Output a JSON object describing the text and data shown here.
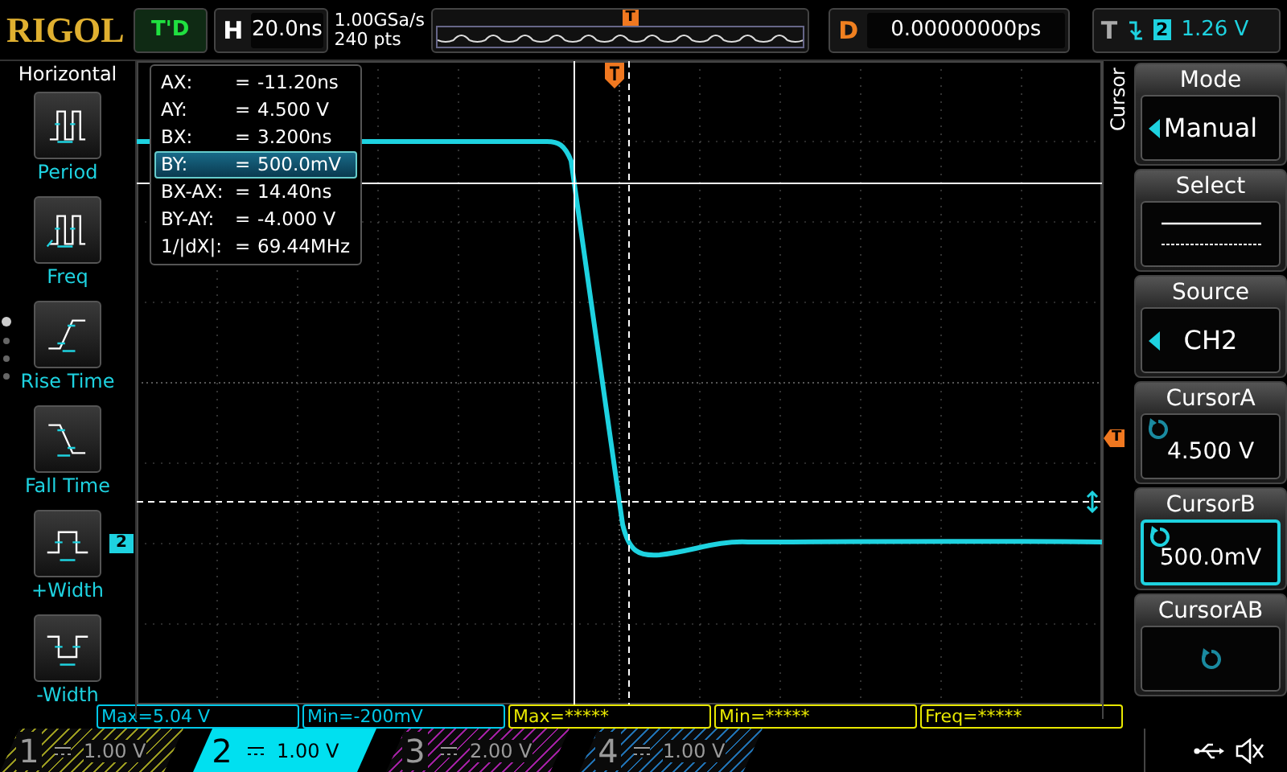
{
  "top_bar": {
    "logo": "RIGOL",
    "run_status": "T'D",
    "timebase": {
      "label": "H",
      "value": "20.0ns"
    },
    "sample_rate": "1.00GSa/s",
    "memory_depth": "240 pts",
    "trigger_position_marker": "T",
    "delay": {
      "label": "D",
      "value": "0.00000000ps"
    },
    "trigger": {
      "label": "T",
      "source": "2",
      "level": "1.26 V"
    }
  },
  "left_menu": {
    "title": "Horizontal",
    "items": [
      {
        "label": "Period",
        "kind": "period"
      },
      {
        "label": "Freq",
        "kind": "freq"
      },
      {
        "label": "Rise Time",
        "kind": "rise"
      },
      {
        "label": "Fall Time",
        "kind": "fall"
      },
      {
        "label": "+Width",
        "kind": "pwidth"
      },
      {
        "label": "-Width",
        "kind": "nwidth"
      }
    ]
  },
  "screen": {
    "channel_marker": "2",
    "trigger_level_marker": "T",
    "cursor_readout": [
      {
        "label": "AX:",
        "sign": "=",
        "value": "-11.20ns",
        "selected": false
      },
      {
        "label": "AY:",
        "sign": "=",
        "value": "4.500 V",
        "selected": false
      },
      {
        "label": "BX:",
        "sign": "=",
        "value": "3.200ns",
        "selected": false
      },
      {
        "label": "BY:",
        "sign": "=",
        "value": "500.0mV",
        "selected": true
      },
      {
        "label": "BX-AX:",
        "sign": "=",
        "value": "14.40ns",
        "selected": false
      },
      {
        "label": "BY-AY:",
        "sign": "=",
        "value": "-4.000 V",
        "selected": false
      },
      {
        "label": "1/|dX|:",
        "sign": "=",
        "value": "69.44MHz",
        "selected": false
      }
    ]
  },
  "right_menu": {
    "title": "Cursor",
    "items": [
      {
        "label": "Mode",
        "kind": "choice",
        "value": "Manual"
      },
      {
        "label": "Select",
        "kind": "lines"
      },
      {
        "label": "Source",
        "kind": "choice",
        "value": "CH2"
      },
      {
        "label": "CursorA",
        "kind": "knob",
        "value": "4.500 V",
        "selected": false
      },
      {
        "label": "CursorB",
        "kind": "knob",
        "value": "500.0mV",
        "selected": true
      },
      {
        "label": "CursorAB",
        "kind": "knob",
        "selected": false
      }
    ]
  },
  "measurements": [
    {
      "text": "Max=5.04 V",
      "color": "#00c8e8"
    },
    {
      "text": "Min=-200mV",
      "color": "#00c8e8"
    },
    {
      "text": "Max=*****",
      "color": "#e8e800"
    },
    {
      "text": "Min=*****",
      "color": "#e8e800"
    },
    {
      "text": "Freq=*****",
      "color": "#e8e800"
    }
  ],
  "channels": [
    {
      "number": "1",
      "scale": "1.00 V",
      "selected": false,
      "color": "#9a9a20"
    },
    {
      "number": "2",
      "scale": "1.00 V",
      "selected": true,
      "color": "#00e0f0"
    },
    {
      "number": "3",
      "scale": "2.00 V",
      "selected": false,
      "color": "#a020a0"
    },
    {
      "number": "4",
      "scale": "1.00 V",
      "selected": false,
      "color": "#2070b0"
    }
  ]
}
